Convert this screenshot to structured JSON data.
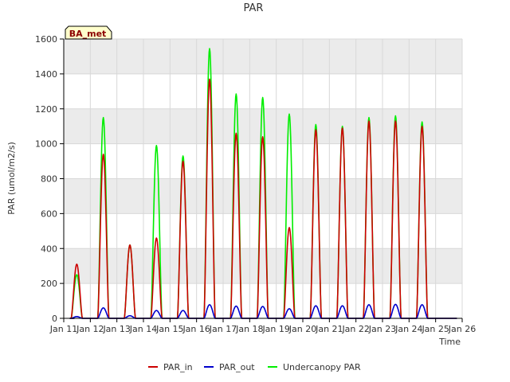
{
  "chart_data": {
    "type": "line",
    "title": "PAR",
    "xlabel": "Time",
    "ylabel": "PAR (umol/m2/s)",
    "badge": "BA_met",
    "x_tick_labels": [
      "Jan 11",
      "Jan 12",
      "Jan 13",
      "Jan 14",
      "Jan 15",
      "Jan 16",
      "Jan 17",
      "Jan 18",
      "Jan 19",
      "Jan 20",
      "Jan 21",
      "Jan 22",
      "Jan 23",
      "Jan 24",
      "Jan 25",
      "Jan 26"
    ],
    "x_range_days": [
      11,
      26
    ],
    "ylim": [
      0,
      1600
    ],
    "y_ticks": [
      0,
      200,
      400,
      600,
      800,
      1000,
      1200,
      1400,
      1600
    ],
    "grid": true,
    "legend_position": "bottom",
    "colors": {
      "PAR_in": "#cc0000",
      "PAR_out": "#0000cc",
      "Undercanopy PAR": "#00ee00",
      "band": "#ebebeb",
      "badge_bg": "#ffffcc",
      "badge_text": "#8b0000"
    },
    "series": [
      {
        "name": "PAR_in",
        "color": "#cc0000",
        "daily_peaks": [
          {
            "day": "Jan 11",
            "peak": 310
          },
          {
            "day": "Jan 12",
            "peak": 940
          },
          {
            "day": "Jan 13",
            "peak": 420
          },
          {
            "day": "Jan 14",
            "peak": 460
          },
          {
            "day": "Jan 15",
            "peak": 900
          },
          {
            "day": "Jan 16",
            "peak": 1370
          },
          {
            "day": "Jan 17",
            "peak": 1060
          },
          {
            "day": "Jan 18",
            "peak": 1040
          },
          {
            "day": "Jan 19",
            "peak": 520
          },
          {
            "day": "Jan 20",
            "peak": 1080
          },
          {
            "day": "Jan 21",
            "peak": 1090
          },
          {
            "day": "Jan 22",
            "peak": 1130
          },
          {
            "day": "Jan 23",
            "peak": 1130
          },
          {
            "day": "Jan 24",
            "peak": 1100
          }
        ]
      },
      {
        "name": "PAR_out",
        "color": "#0000cc",
        "daily_peaks": [
          {
            "day": "Jan 11",
            "peak": 10
          },
          {
            "day": "Jan 12",
            "peak": 60
          },
          {
            "day": "Jan 13",
            "peak": 15
          },
          {
            "day": "Jan 14",
            "peak": 45
          },
          {
            "day": "Jan 15",
            "peak": 45
          },
          {
            "day": "Jan 16",
            "peak": 78
          },
          {
            "day": "Jan 17",
            "peak": 70
          },
          {
            "day": "Jan 18",
            "peak": 68
          },
          {
            "day": "Jan 19",
            "peak": 55
          },
          {
            "day": "Jan 20",
            "peak": 72
          },
          {
            "day": "Jan 21",
            "peak": 72
          },
          {
            "day": "Jan 22",
            "peak": 78
          },
          {
            "day": "Jan 23",
            "peak": 80
          },
          {
            "day": "Jan 24",
            "peak": 78
          }
        ]
      },
      {
        "name": "Undercanopy PAR",
        "color": "#00ee00",
        "daily_peaks": [
          {
            "day": "Jan 11",
            "peak": 250
          },
          {
            "day": "Jan 12",
            "peak": 1150
          },
          {
            "day": "Jan 13",
            "peak": 420
          },
          {
            "day": "Jan 14",
            "peak": 990
          },
          {
            "day": "Jan 15",
            "peak": 930
          },
          {
            "day": "Jan 16",
            "peak": 1545
          },
          {
            "day": "Jan 17",
            "peak": 1285
          },
          {
            "day": "Jan 18",
            "peak": 1265
          },
          {
            "day": "Jan 19",
            "peak": 1170
          },
          {
            "day": "Jan 20",
            "peak": 1110
          },
          {
            "day": "Jan 21",
            "peak": 1100
          },
          {
            "day": "Jan 22",
            "peak": 1150
          },
          {
            "day": "Jan 23",
            "peak": 1160
          },
          {
            "day": "Jan 24",
            "peak": 1125
          }
        ]
      }
    ]
  }
}
